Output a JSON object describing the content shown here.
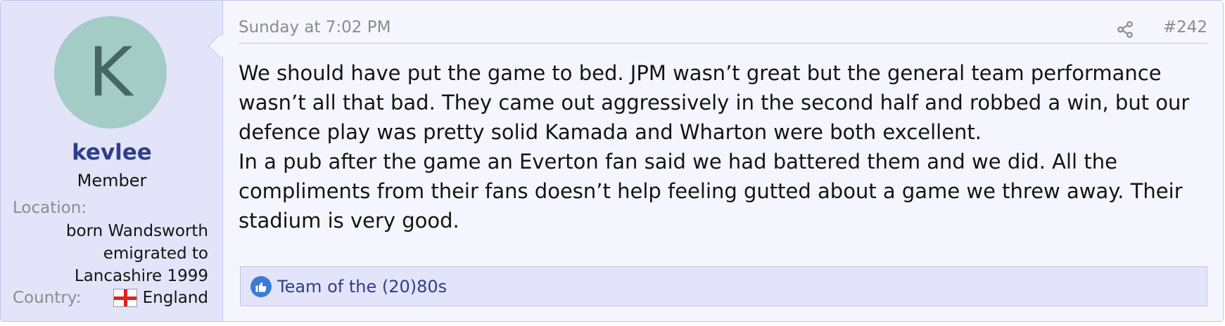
{
  "user": {
    "avatar_letter": "K",
    "username": "kevlee",
    "title": "Member",
    "location_label": "Location:",
    "location_lines": [
      "born Wandsworth",
      "emigrated to",
      "Lancashire 1999"
    ],
    "country_label": "Country:",
    "country": "England"
  },
  "post": {
    "date": "Sunday at 7:02 PM",
    "number": "#242",
    "paragraphs": [
      "We should have put the game to bed. JPM wasn’t great but the general team performance wasn’t all that bad. They came out aggressively in the second half and robbed a win, but our defence play was pretty solid Kamada and Wharton were both excellent.",
      "In a pub after the game an Everton fan said we had battered them and we did. All the compliments from their fans doesn’t help feeling gutted about a game we threw away. Their stadium is very good."
    ],
    "reactions": "Team of the (20)80s"
  },
  "colors": {
    "user_bg": "#e3e3fa",
    "post_bg": "#f5f5fd",
    "username": "#2e3f87",
    "avatar_bg": "#a3ccc6",
    "avatar_text": "#466862",
    "like_icon": "#3a7bd5"
  },
  "icons": {
    "share": "share-icon",
    "like": "thumbs-up-icon",
    "flag": "england-flag-icon"
  }
}
